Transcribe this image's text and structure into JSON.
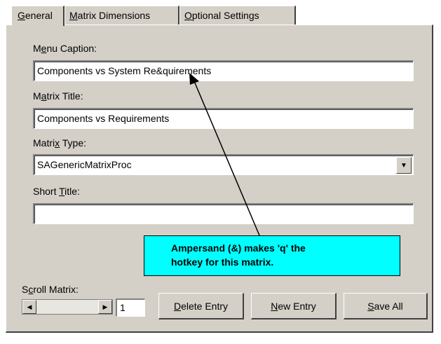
{
  "tabs": [
    {
      "label_pre": "",
      "hotkey": "G",
      "label_post": "eneral"
    },
    {
      "label_pre": "",
      "hotkey": "M",
      "label_post": "atrix Dimensions"
    },
    {
      "label_pre": "",
      "hotkey": "O",
      "label_post": "ptional Settings"
    }
  ],
  "menu_caption": {
    "label_pre": "M",
    "hotkey": "e",
    "label_post": "nu Caption:",
    "value": "Components vs System Re&quirements"
  },
  "matrix_title": {
    "label_pre": "M",
    "hotkey": "a",
    "label_post": "trix Title:",
    "value": "Components vs Requirements"
  },
  "matrix_type": {
    "label_pre": "Matri",
    "hotkey": "x",
    "label_post": " Type:",
    "value": "SAGenericMatrixProc"
  },
  "short_title": {
    "label_pre": "Short ",
    "hotkey": "T",
    "label_post": "itle:",
    "value": ""
  },
  "callout": {
    "line1": "Ampersand (&) makes 'q' the",
    "line2": "hotkey for this matrix."
  },
  "scroll": {
    "label_pre": "S",
    "hotkey": "c",
    "label_post": "roll Matrix:",
    "value": "1"
  },
  "buttons": {
    "delete": {
      "hotkey": "D",
      "rest": "elete Entry"
    },
    "new": {
      "hotkey": "N",
      "rest": "ew Entry"
    },
    "save": {
      "hotkey": "S",
      "rest": "ave All"
    }
  },
  "colors": {
    "callout_bg": "#00ffff",
    "dialog_bg": "#d4d0c8"
  },
  "icons": {
    "dropdown": "chevron-down-icon",
    "scroll_left": "arrow-left-icon",
    "scroll_right": "arrow-right-icon"
  }
}
